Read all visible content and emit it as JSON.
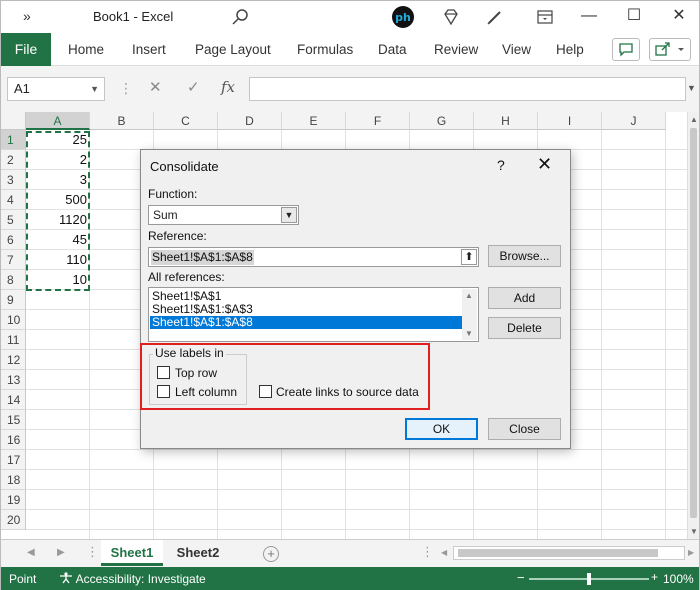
{
  "titlebar": {
    "chevron": "»",
    "title": "Book1  -  Excel",
    "minimize": "—",
    "maximize": "☐",
    "close": "✕"
  },
  "ribbon": {
    "file": "File",
    "tabs": [
      "Home",
      "Insert",
      "Page Layout",
      "Formulas",
      "Data",
      "Review",
      "View",
      "Help"
    ]
  },
  "formula_bar": {
    "name_box": "A1",
    "fx": "fx",
    "cancel": "✕",
    "enter": "✓"
  },
  "grid": {
    "columns": [
      "A",
      "B",
      "C",
      "D",
      "E",
      "F",
      "G",
      "H",
      "I",
      "J"
    ],
    "rows": [
      "1",
      "2",
      "3",
      "4",
      "5",
      "6",
      "7",
      "8",
      "9",
      "10",
      "11",
      "12",
      "13",
      "14",
      "15",
      "16",
      "17",
      "18",
      "19",
      "20"
    ],
    "column_a_values": [
      "25",
      "2",
      "3",
      "500",
      "1120",
      "45",
      "110",
      "10"
    ]
  },
  "sheets": {
    "tabs": [
      "Sheet1",
      "Sheet2"
    ],
    "active": "Sheet1",
    "add": "+"
  },
  "status": {
    "mode": "Point",
    "accessibility": "Accessibility: Investigate",
    "zoom": "100%"
  },
  "dialog": {
    "title": "Consolidate",
    "help": "?",
    "close": "✕",
    "function_label": "Function:",
    "function_value": "Sum",
    "reference_label": "Reference:",
    "reference_value": "Sheet1!$A$1:$A$8",
    "browse": "Browse...",
    "all_references_label": "All references:",
    "all_references": [
      "Sheet1!$A$1",
      "Sheet1!$A$1:$A$3",
      "Sheet1!$A$1:$A$8"
    ],
    "selected_reference": "Sheet1!$A$1:$A$8",
    "add": "Add",
    "delete": "Delete",
    "use_labels_in": "Use labels in",
    "top_row": "Top row",
    "left_column": "Left column",
    "create_links": "Create links to source data",
    "ok": "OK",
    "close_button": "Close"
  },
  "colors": {
    "excel_green": "#217346",
    "selection_blue": "#0078d7",
    "highlight_red": "#e02020"
  }
}
